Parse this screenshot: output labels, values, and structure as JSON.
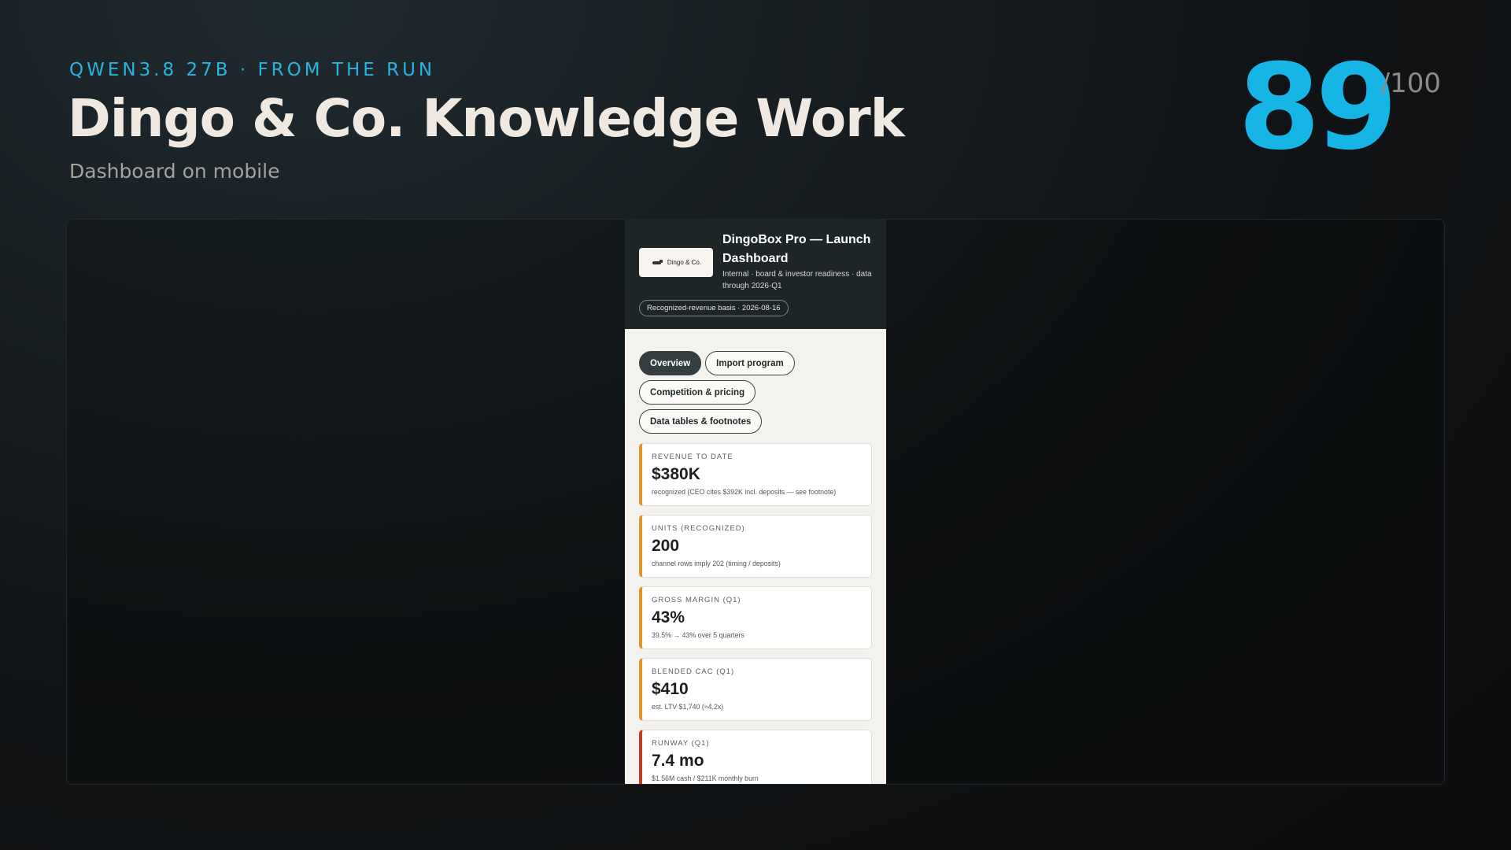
{
  "slide": {
    "eyebrow": "QWEN3.8 27B · FROM THE RUN",
    "title": "Dingo & Co. Knowledge Work",
    "subtitle": "Dashboard on mobile",
    "score": "89",
    "score_max": "/100"
  },
  "app": {
    "logo_text": "Dingo & Co.",
    "title": "DingoBox Pro — Launch Dashboard",
    "subtitle": "Internal · board & investor readiness · data through 2026-Q1",
    "basis_pill": "Recognized-revenue basis · 2026-08-16",
    "tabs": [
      {
        "label": "Overview",
        "active": true
      },
      {
        "label": "Import program",
        "active": false
      },
      {
        "label": "Competition & pricing",
        "active": false
      },
      {
        "label": "Data tables & footnotes",
        "active": false
      }
    ],
    "cards": [
      {
        "label": "REVENUE TO DATE",
        "value": "$380K",
        "note": "recognized (CEO cites $392K incl. deposits — see footnote)",
        "accent": "#d9962b"
      },
      {
        "label": "UNITS (RECOGNIZED)",
        "value": "200",
        "note": "channel rows imply 202 (timing / deposits)",
        "accent": "#d9962b"
      },
      {
        "label": "GROSS MARGIN (Q1)",
        "value": "43%",
        "note": "39.5% → 43% over 5 quarters",
        "accent": "#d9962b"
      },
      {
        "label": "BLENDED CAC (Q1)",
        "value": "$410",
        "note": "est. LTV $1,740 (≈4.2x)",
        "accent": "#d9962b"
      },
      {
        "label": "RUNWAY (Q1)",
        "value": "7.4 mo",
        "note": "$1.56M cash / $211K monthly burn",
        "accent": "#c0392b"
      }
    ]
  }
}
